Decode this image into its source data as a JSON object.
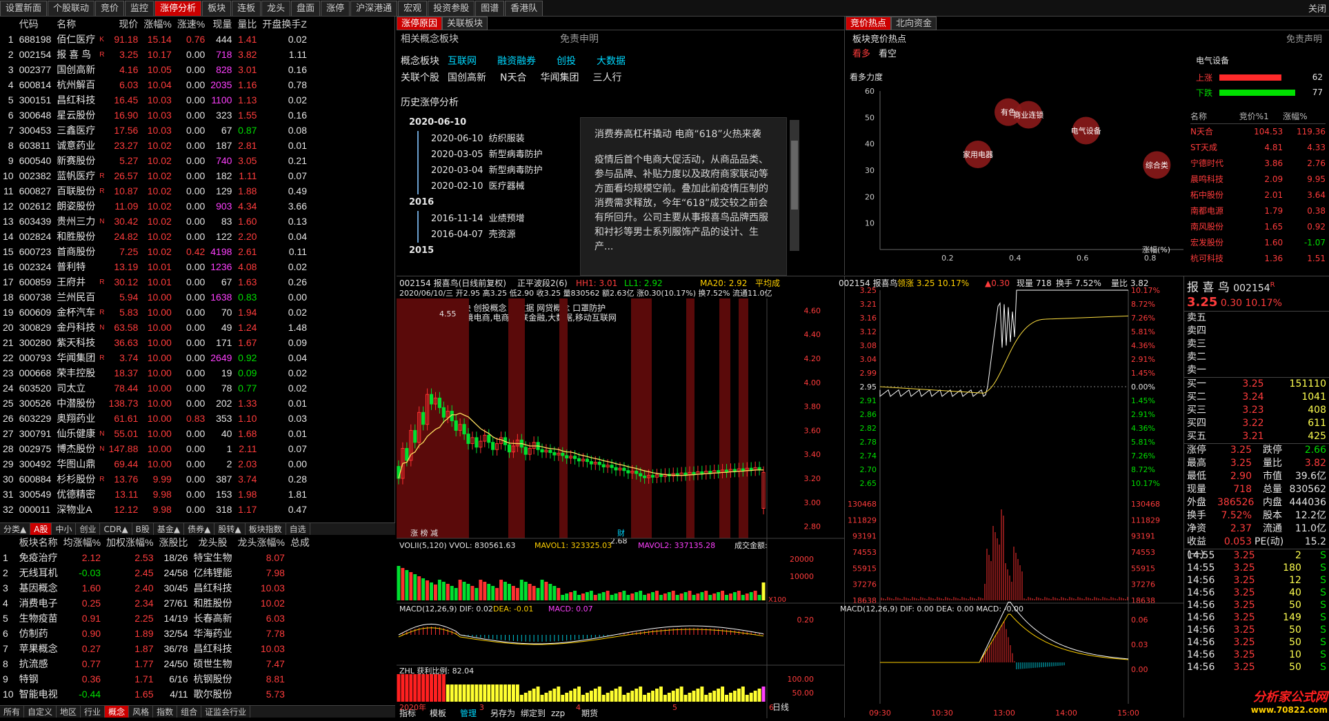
{
  "topbar": {
    "tabs": [
      "设置新面",
      "个股联动",
      "竞价",
      "监控",
      "涨停分析",
      "板块",
      "连板",
      "龙头",
      "盘面",
      "涨停",
      "沪深港通",
      "宏观",
      "投资参股",
      "图谱",
      "香港队"
    ],
    "active": 4,
    "close": "关闭"
  },
  "stocks": {
    "headers": [
      "代码",
      "名称",
      "现价",
      "涨幅%",
      "涨速%",
      "现量",
      "量比",
      "开盘换手Z"
    ],
    "rows": [
      [
        "1",
        "688198",
        "佰仁医疗",
        "K",
        "91.18",
        "15.14",
        "0.76",
        "444",
        "1.41",
        "0.02"
      ],
      [
        "2",
        "002154",
        "报 喜 鸟",
        "R",
        "3.25",
        "10.17",
        "0.00",
        "718",
        "3.82",
        "1.11"
      ],
      [
        "3",
        "002377",
        "国创高新",
        "",
        "4.16",
        "10.05",
        "0.00",
        "828",
        "3.01",
        "0.16"
      ],
      [
        "4",
        "600814",
        "杭州解百",
        "",
        "6.03",
        "10.04",
        "0.00",
        "2035",
        "1.16",
        "0.78"
      ],
      [
        "5",
        "300151",
        "昌红科技",
        "",
        "16.45",
        "10.03",
        "0.00",
        "1100",
        "1.13",
        "0.02"
      ],
      [
        "6",
        "300648",
        "星云股份",
        "",
        "16.90",
        "10.03",
        "0.00",
        "323",
        "1.55",
        "0.16"
      ],
      [
        "7",
        "300453",
        "三鑫医疗",
        "",
        "17.56",
        "10.03",
        "0.00",
        "67",
        "0.87",
        "0.08"
      ],
      [
        "8",
        "603811",
        "诚意药业",
        "",
        "23.27",
        "10.02",
        "0.00",
        "187",
        "2.81",
        "0.01"
      ],
      [
        "9",
        "600540",
        "新赛股份",
        "",
        "5.27",
        "10.02",
        "0.00",
        "740",
        "3.05",
        "0.21"
      ],
      [
        "10",
        "002382",
        "蓝帆医疗",
        "R",
        "26.57",
        "10.02",
        "0.00",
        "182",
        "1.11",
        "0.07"
      ],
      [
        "11",
        "600827",
        "百联股份",
        "R",
        "10.87",
        "10.02",
        "0.00",
        "129",
        "1.88",
        "0.49"
      ],
      [
        "12",
        "002612",
        "朗姿股份",
        "",
        "11.09",
        "10.02",
        "0.00",
        "903",
        "4.34",
        "3.66"
      ],
      [
        "13",
        "603439",
        "贵州三力",
        "N",
        "30.42",
        "10.02",
        "0.00",
        "83",
        "1.60",
        "0.13"
      ],
      [
        "14",
        "002824",
        "和胜股份",
        "",
        "24.82",
        "10.02",
        "0.00",
        "122",
        "2.20",
        "0.04"
      ],
      [
        "15",
        "600723",
        "首商股份",
        "",
        "7.25",
        "10.02",
        "0.42",
        "4198",
        "2.61",
        "0.11"
      ],
      [
        "16",
        "002324",
        "普利特",
        "",
        "13.19",
        "10.01",
        "0.00",
        "1236",
        "4.08",
        "0.02"
      ],
      [
        "17",
        "600859",
        "王府井",
        "R",
        "30.12",
        "10.01",
        "0.00",
        "67",
        "1.63",
        "0.26"
      ],
      [
        "18",
        "600738",
        "兰州民百",
        "",
        "5.94",
        "10.00",
        "0.00",
        "1638",
        "0.83",
        "0.00"
      ],
      [
        "19",
        "600609",
        "金杯汽车",
        "R",
        "5.83",
        "10.00",
        "0.00",
        "70",
        "1.94",
        "0.02"
      ],
      [
        "20",
        "300829",
        "金丹科技",
        "N",
        "63.58",
        "10.00",
        "0.00",
        "49",
        "1.24",
        "1.48"
      ],
      [
        "21",
        "300280",
        "紫天科技",
        "",
        "36.63",
        "10.00",
        "0.00",
        "171",
        "1.67",
        "0.09"
      ],
      [
        "22",
        "000793",
        "华闻集团",
        "R",
        "3.74",
        "10.00",
        "0.00",
        "2649",
        "0.92",
        "0.04"
      ],
      [
        "23",
        "000668",
        "荣丰控股",
        "",
        "18.37",
        "10.00",
        "0.00",
        "19",
        "0.09",
        "0.02"
      ],
      [
        "24",
        "603520",
        "司太立",
        "",
        "78.44",
        "10.00",
        "0.00",
        "78",
        "0.77",
        "0.02"
      ],
      [
        "25",
        "300526",
        "中潜股份",
        "",
        "138.73",
        "10.00",
        "0.00",
        "202",
        "1.33",
        "0.01"
      ],
      [
        "26",
        "603229",
        "奥翔药业",
        "",
        "61.61",
        "10.00",
        "0.83",
        "353",
        "1.10",
        "0.03"
      ],
      [
        "27",
        "300791",
        "仙乐健康",
        "N",
        "55.01",
        "10.00",
        "0.00",
        "40",
        "1.68",
        "0.01"
      ],
      [
        "28",
        "002975",
        "博杰股份",
        "N",
        "147.88",
        "10.00",
        "0.00",
        "1",
        "2.11",
        "0.07"
      ],
      [
        "29",
        "300492",
        "华图山鼎",
        "",
        "69.44",
        "10.00",
        "0.00",
        "2",
        "2.03",
        "0.00"
      ],
      [
        "30",
        "600884",
        "杉杉股份",
        "R",
        "13.76",
        "9.99",
        "0.00",
        "387",
        "3.74",
        "0.28"
      ],
      [
        "31",
        "300549",
        "优德精密",
        "",
        "13.11",
        "9.98",
        "0.00",
        "153",
        "1.98",
        "1.81"
      ],
      [
        "32",
        "000011",
        "深物业A",
        "",
        "12.12",
        "9.98",
        "0.00",
        "318",
        "1.17",
        "0.47"
      ]
    ]
  },
  "catbar": [
    "分类▲",
    "A股",
    "中小",
    "创业",
    "CDR▲",
    "B股",
    "基金▲",
    "债券▲",
    "股转▲",
    "板块指数",
    "自选"
  ],
  "blocks": {
    "headers": [
      "板块名称",
      "均涨幅%",
      "加权涨幅%",
      "涨股比",
      "龙头股",
      "龙头涨幅%",
      "总成"
    ],
    "rows": [
      [
        "1",
        "免疫治疗",
        "2.12",
        "2.53",
        "18/26",
        "特宝生物",
        "8.07"
      ],
      [
        "2",
        "无线耳机",
        "-0.03",
        "2.45",
        "24/58",
        "亿纬锂能",
        "7.98"
      ],
      [
        "3",
        "基因概念",
        "1.60",
        "2.40",
        "30/45",
        "昌红科技",
        "10.03"
      ],
      [
        "4",
        "消费电子",
        "0.25",
        "2.34",
        "27/61",
        "和胜股份",
        "10.02"
      ],
      [
        "5",
        "生物疫苗",
        "0.91",
        "2.25",
        "14/19",
        "长春高新",
        "6.03"
      ],
      [
        "6",
        "仿制药",
        "0.90",
        "1.89",
        "32/54",
        "华海药业",
        "7.78"
      ],
      [
        "7",
        "苹果概念",
        "0.27",
        "1.87",
        "36/78",
        "昌红科技",
        "10.03"
      ],
      [
        "8",
        "抗流感",
        "0.77",
        "1.77",
        "24/50",
        "硕世生物",
        "7.47"
      ],
      [
        "9",
        "特钢",
        "0.36",
        "1.71",
        "6/16",
        "杭钢股份",
        "8.81"
      ],
      [
        "10",
        "智能电视",
        "-0.44",
        "1.65",
        "4/11",
        "歌尔股份",
        "5.73"
      ]
    ]
  },
  "btmbar": [
    "所有",
    "自定义",
    "地区",
    "行业",
    "概念",
    "风格",
    "指数",
    "组合",
    "证监会行业"
  ],
  "concept": {
    "tabs": [
      "涨停原因",
      "关联板块"
    ],
    "title": "相关概念板块",
    "disclaimer": "免责申明",
    "concept_label": "概念板块",
    "concepts": [
      "互联网",
      "融资融券",
      "创投",
      "大数据"
    ],
    "related_label": "关联个股",
    "related": [
      "国创高新",
      "N天合",
      "华闻集团",
      "三人行"
    ],
    "history_title": "历史涨停分析",
    "history": [
      {
        "date": "2020-06-10",
        "items": [
          [
            "2020-06-10",
            "纺织服装"
          ],
          [
            "2020-03-05",
            "新型病毒防护"
          ],
          [
            "2020-03-04",
            "新型病毒防护"
          ],
          [
            "2020-02-10",
            "医疗器械"
          ]
        ]
      },
      {
        "date": "2016",
        "items": [
          [
            "2016-11-14",
            "业绩预增"
          ],
          [
            "2016-04-07",
            "壳资源"
          ]
        ]
      },
      {
        "date": "2015",
        "items": []
      }
    ],
    "popup_title": "消费券高杠杆撬动 电商“618”火热来袭",
    "popup_body": "疫情后首个电商大促活动，从商品品类、参与品牌、补贴力度以及政府商家联动等方面看均规模空前。叠加此前疫情压制的消费需求释放，今年“618”成交较之前会有所回升。公司主要从事报喜鸟品牌西服和衬衫等男士系列服饰产品的设计、生产..."
  },
  "hot": {
    "tabs": [
      "竞价热点",
      "北向资金"
    ],
    "title": "板块竞价热点",
    "disclaimer": "免责声明",
    "sub": [
      "看多",
      "看空"
    ],
    "ylabel": "看多力度",
    "xlabel": "涨幅(%)",
    "bubbles": [
      {
        "n": "有色",
        "x": 0.38,
        "y": 52
      },
      {
        "n": "商业连锁",
        "x": 0.44,
        "y": 51
      },
      {
        "n": "电气设备",
        "x": 0.61,
        "y": 45
      },
      {
        "n": "家用电器",
        "x": 0.29,
        "y": 36
      },
      {
        "n": "综合类",
        "x": 0.82,
        "y": 32
      }
    ],
    "yticks": [
      "60",
      "50",
      "40",
      "30",
      "20",
      "10"
    ],
    "xticks": [
      "0.2",
      "0.4",
      "0.6",
      "0.8"
    ],
    "sector": "电气设备",
    "up_label": "上涨",
    "up": "62",
    "down_label": "下跌",
    "down": "77",
    "list_headers": [
      "名称",
      "竞价%1",
      "涨幅%"
    ],
    "list": [
      [
        "N天合",
        "104.53",
        "119.36"
      ],
      [
        "ST天成",
        "4.81",
        "4.33"
      ],
      [
        "宁德时代",
        "3.86",
        "2.76"
      ],
      [
        "晨鸣科技",
        "2.09",
        "9.95"
      ],
      [
        "柘中股份",
        "2.01",
        "3.64"
      ],
      [
        "南都电源",
        "1.79",
        "0.38"
      ],
      [
        "南风股份",
        "1.65",
        "0.92"
      ],
      [
        "宏发股份",
        "1.60",
        "-1.07"
      ],
      [
        "杭可科技",
        "1.36",
        "1.51"
      ]
    ]
  },
  "kline": {
    "header": "002154 报喜鸟(日线前复权)",
    "wave": "正平波段2(6)",
    "hh": "HH1: 3.01",
    "ll": "LL1: 2.92",
    "ma20": "MA20: 2.92",
    "ma_extra": "平均成",
    "info": "2020/06/10/三 开2.95 高3.25 低2.90 收3.25 量830562 额2.63亿 涨0.30(10.17%) 换7.52% 流通11.0亿",
    "tag1": "纺织服装 浙江板块 创投概念 大数据 网贷概念 口罩防护",
    "tag2": "创投,电子商务,跨境电商,电商,互联金融,大数据,移动互联网",
    "hi": "4.55",
    "lo": "2.68",
    "ticks": [
      "4.60",
      "4.40",
      "4.20",
      "4.00",
      "3.80",
      "3.60",
      "3.40",
      "3.20",
      "3.00",
      "2.80"
    ],
    "mark1": "涨 榜 减",
    "mark2": "财",
    "vol": "VOLII(5,120) VVOL: 830561.63",
    "mavol1": "MAVOL1: 323325.03",
    "mavol2": "MAVOL2: 337135.28",
    "vol_extra": "成交金额:",
    "volticks": [
      "20000",
      "10000"
    ],
    "volunit": "X100",
    "macd": "MACD(12,26,9) DIF: 0.02",
    "dea": "DEA: -0.01",
    "macdv": "MACD: 0.07",
    "macdtick": "0.20",
    "zhl": "ZHL 获利比例: 82.04",
    "zhlticks": [
      "100.00",
      "50.00"
    ],
    "year": "2020年",
    "months": [
      "3",
      "4",
      "5",
      "6"
    ],
    "period": "日线",
    "tools": [
      "指标",
      "模板",
      "管理",
      "另存为",
      "绑定到",
      "zzp",
      "期货"
    ]
  },
  "tick": {
    "header": "002154 报喜鸟",
    "lead": "领涨 3.25 10.17%",
    "chg": "▲0.30",
    "vol": "现量 718",
    "turn": "换手 7.52%",
    "lb": "量比 3.82",
    "left": [
      "3.25",
      "3.21",
      "3.16",
      "3.12",
      "3.08",
      "3.04",
      "2.99",
      "2.95",
      "2.91",
      "2.86",
      "2.82",
      "2.78",
      "2.74",
      "2.70",
      "2.65"
    ],
    "right": [
      "10.17%",
      "8.72%",
      "7.26%",
      "5.81%",
      "4.36%",
      "2.91%",
      "1.45%",
      "0.00%",
      "1.45%",
      "2.91%",
      "4.36%",
      "5.81%",
      "7.26%",
      "8.72%",
      "10.17%"
    ],
    "vleft": [
      "130468",
      "111829",
      "93191",
      "74553",
      "55915",
      "37276",
      "18638"
    ],
    "macd": "MACD(12,26,9) DIF: 0.00 DEA: 0.00 MACD: -0.00",
    "macdticks": [
      "0.06",
      "0.03",
      "0.00"
    ],
    "times": [
      "09:30",
      "10:30",
      "13:00",
      "14:00",
      "15:00"
    ]
  },
  "quote": {
    "name": "报 喜 鸟",
    "code": "002154",
    "flag": "R",
    "price": "3.25",
    "chg": "0.30",
    "pct": "10.17%",
    "sells": [
      "卖五",
      "卖四",
      "卖三",
      "卖二",
      "卖一"
    ],
    "buys": [
      [
        "买一",
        "3.25",
        "151110"
      ],
      [
        "买二",
        "3.24",
        "1041"
      ],
      [
        "买三",
        "3.23",
        "408"
      ],
      [
        "买四",
        "3.22",
        "611"
      ],
      [
        "买五",
        "3.21",
        "425"
      ]
    ],
    "stats": [
      [
        "涨停",
        "3.25",
        "跌停",
        "2.66"
      ],
      [
        "最高",
        "3.25",
        "量比",
        "3.82"
      ],
      [
        "最低",
        "2.90",
        "市值",
        "39.6亿"
      ],
      [
        "现量",
        "718",
        "总量",
        "830562"
      ],
      [
        "外盘",
        "386526",
        "内盘",
        "444036"
      ],
      [
        "换手",
        "7.52%",
        "股本",
        "12.2亿"
      ],
      [
        "净资",
        "2.37",
        "流通",
        "11.0亿"
      ],
      [
        "收益(一)",
        "0.053",
        "PE(动)",
        "15.2"
      ]
    ],
    "trades": [
      [
        "14:55",
        "3.25",
        "2",
        "S"
      ],
      [
        "14:55",
        "3.25",
        "180",
        "S"
      ],
      [
        "14:56",
        "3.25",
        "12",
        "S"
      ],
      [
        "14:56",
        "3.25",
        "40",
        "S"
      ],
      [
        "14:56",
        "3.25",
        "50",
        "S"
      ],
      [
        "14:56",
        "3.25",
        "149",
        "S"
      ],
      [
        "14:56",
        "3.25",
        "50",
        "S"
      ],
      [
        "14:56",
        "3.25",
        "50",
        "S"
      ],
      [
        "14:56",
        "3.25",
        "10",
        "S"
      ],
      [
        "14:56",
        "3.25",
        "50",
        "S"
      ]
    ],
    "watermark": "分析家公式网",
    "url": "www.70822.com"
  }
}
